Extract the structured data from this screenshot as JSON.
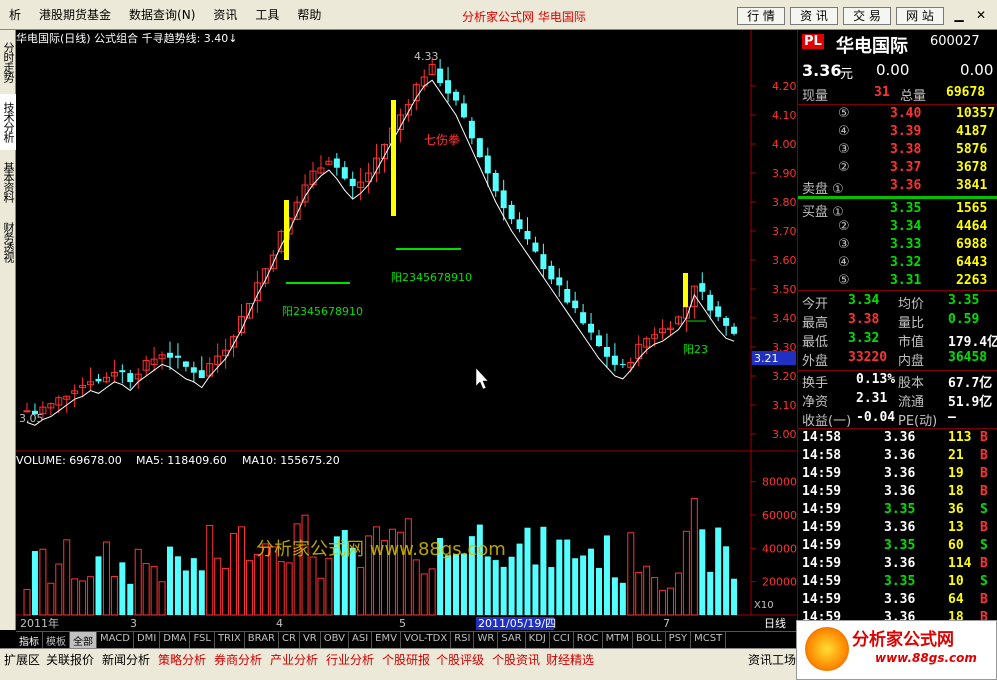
{
  "menu": {
    "items": [
      "析",
      "港股期货基金",
      "数据查询(N)",
      "资讯",
      "工具",
      "帮助"
    ],
    "center_title": "分析家公式网 华电国际",
    "right_buttons": [
      "行 情",
      "资 讯",
      "交 易",
      "网 站"
    ]
  },
  "left_tabs": [
    "分时走势",
    "技术分析",
    "基本资料",
    "财务透视"
  ],
  "chart": {
    "header": "华电国际(日线) 公式组合 千寻趋势线: 3.40↓",
    "y_ticks": [
      "4.20",
      "4.10",
      "4.00",
      "3.90",
      "3.80",
      "3.70",
      "3.60",
      "3.50",
      "3.40",
      "3.30",
      "3.20",
      "3.10",
      "3.00"
    ],
    "current_price_tag": "3.21",
    "annotations": {
      "high": "4.33",
      "low": "3.05",
      "qishang": "七伤拳",
      "yang1": "阳2345678910",
      "yang2": "阳2345678910",
      "yang3": "阳23"
    },
    "volume_header": {
      "volume": "VOLUME: 69678.00",
      "ma5": "MA5: 118409.60",
      "ma10": "MA10: 155675.20"
    },
    "vol_ticks": [
      "80000",
      "60000",
      "40000",
      "20000"
    ],
    "vol_unit": "X10",
    "x_labels": [
      "2011年",
      "3",
      "4",
      "5",
      "7"
    ],
    "date_marker": "2011/05/19/四",
    "watermark_text": "分析家公式网 www.88gs.com",
    "bottom_right_label": "日线"
  },
  "bottom_tabs": [
    "指标",
    "模板",
    "全部",
    "MACD",
    "DMI",
    "DMA",
    "FSL",
    "TRIX",
    "BRAR",
    "CR",
    "VR",
    "OBV",
    "ASI",
    "EMV",
    "VOL-TDX",
    "RSI",
    "WR",
    "SAR",
    "KDJ",
    "CCI",
    "ROC",
    "MTM",
    "BOLL",
    "PSY",
    "MCST"
  ],
  "quote": {
    "badge": "PL",
    "name": "华电国际",
    "code": "600027",
    "price": "3.36",
    "price_unit": "元",
    "change": "0.00",
    "change_pct": "0.00",
    "xianliang_label": "现量",
    "xianliang": "31",
    "zongliang_label": "总量",
    "zongliang": "69678",
    "sells": [
      {
        "label": "⑤",
        "price": "3.40",
        "vol": "10357"
      },
      {
        "label": "④",
        "price": "3.39",
        "vol": "4187"
      },
      {
        "label": "③",
        "price": "3.38",
        "vol": "5876"
      },
      {
        "label": "②",
        "price": "3.37",
        "vol": "3678"
      },
      {
        "label": "卖盘 ①",
        "price": "3.36",
        "vol": "3841"
      }
    ],
    "buys": [
      {
        "label": "买盘 ①",
        "price": "3.35",
        "vol": "1565"
      },
      {
        "label": "②",
        "price": "3.34",
        "vol": "4464"
      },
      {
        "label": "③",
        "price": "3.33",
        "vol": "6988"
      },
      {
        "label": "④",
        "price": "3.32",
        "vol": "6443"
      },
      {
        "label": "⑤",
        "price": "3.31",
        "vol": "2263"
      }
    ],
    "stats": [
      {
        "l1": "今开",
        "v1": "3.34",
        "c1": "green",
        "l2": "均价",
        "v2": "3.35",
        "c2": "green"
      },
      {
        "l1": "最高",
        "v1": "3.38",
        "c1": "red",
        "l2": "量比",
        "v2": "0.59",
        "c2": "green"
      },
      {
        "l1": "最低",
        "v1": "3.32",
        "c1": "green",
        "l2": "市值",
        "v2": "179.4亿",
        "c2": "white"
      },
      {
        "l1": "外盘",
        "v1": "33220",
        "c1": "red",
        "l2": "内盘",
        "v2": "36458",
        "c2": "green"
      }
    ],
    "fin": [
      {
        "l1": "换手",
        "v1": "0.13%",
        "l2": "股本",
        "v2": "67.7亿"
      },
      {
        "l1": "净资",
        "v1": "2.31",
        "l2": "流通",
        "v2": "51.9亿"
      },
      {
        "l1": "收益(一)",
        "v1": "-0.04",
        "l2": "PE(动)",
        "v2": "—"
      }
    ],
    "ticks": [
      {
        "t": "14:58",
        "p": "3.36",
        "pc": "white",
        "v": "113",
        "s": "B"
      },
      {
        "t": "14:58",
        "p": "3.36",
        "pc": "white",
        "v": "21",
        "s": "B"
      },
      {
        "t": "14:59",
        "p": "3.36",
        "pc": "white",
        "v": "19",
        "s": "B"
      },
      {
        "t": "14:59",
        "p": "3.36",
        "pc": "white",
        "v": "18",
        "s": "B"
      },
      {
        "t": "14:59",
        "p": "3.35",
        "pc": "green",
        "v": "36",
        "s": "S"
      },
      {
        "t": "14:59",
        "p": "3.36",
        "pc": "white",
        "v": "13",
        "s": "B"
      },
      {
        "t": "14:59",
        "p": "3.35",
        "pc": "green",
        "v": "60",
        "s": "S"
      },
      {
        "t": "14:59",
        "p": "3.36",
        "pc": "white",
        "v": "114",
        "s": "B"
      },
      {
        "t": "14:59",
        "p": "3.35",
        "pc": "green",
        "v": "10",
        "s": "S"
      },
      {
        "t": "14:59",
        "p": "3.36",
        "pc": "white",
        "v": "64",
        "s": "B"
      },
      {
        "t": "14:59",
        "p": "3.36",
        "pc": "white",
        "v": "18",
        "s": "B"
      }
    ]
  },
  "status_bar": [
    "扩展区",
    "关联报价",
    "新闻分析",
    "策略分析",
    "券商分析",
    "产业分析",
    "行业分析",
    "个股研报",
    "个股评级",
    "个股资讯",
    "财经精选",
    "资讯工场"
  ],
  "ad": {
    "title": "分析家公式网",
    "url": "www.88gs.com"
  },
  "colors": {
    "up": "#ff3232",
    "down": "#54ffff",
    "ma": "#ffffff",
    "yellow": "#ffff00",
    "green_line": "#00e000"
  }
}
